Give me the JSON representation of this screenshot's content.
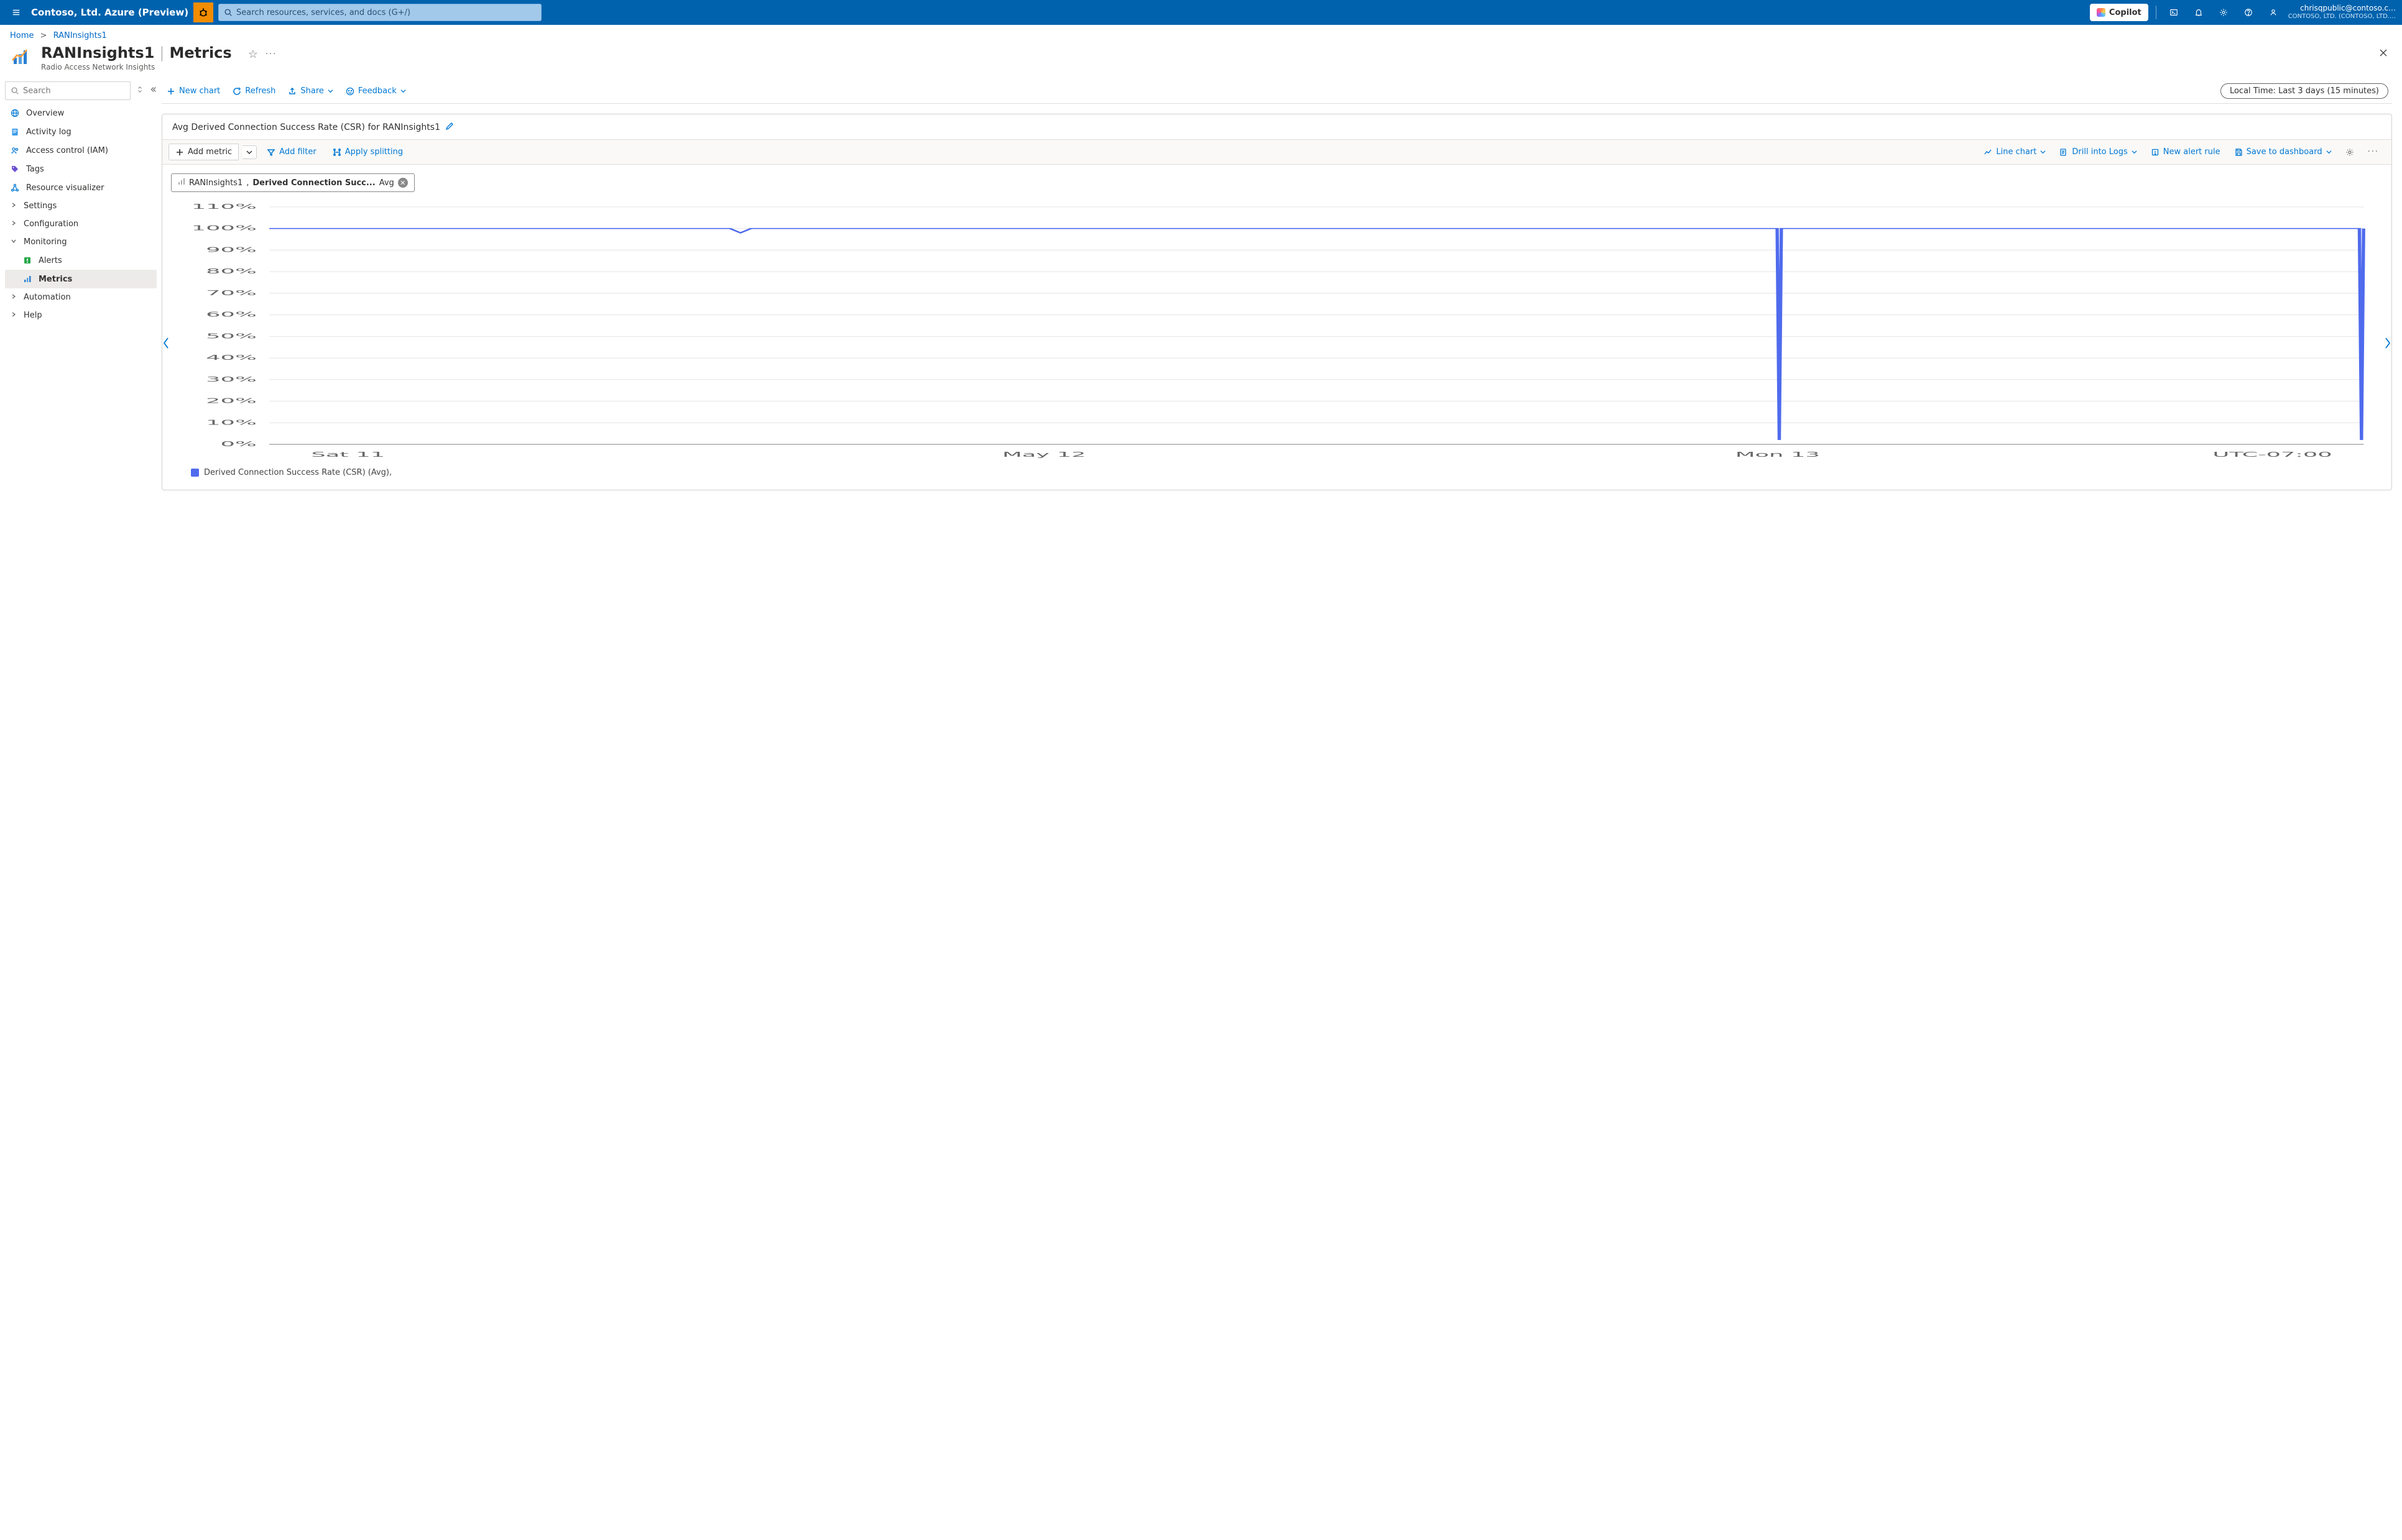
{
  "header": {
    "brand": "Contoso, Ltd. Azure (Preview)",
    "search_placeholder": "Search resources, services, and docs (G+/)",
    "copilot_label": "Copilot",
    "account_email": "chrisqpublic@contoso.c…",
    "account_tenant": "CONTOSO, LTD. (CONTOSO, LTD.…"
  },
  "breadcrumb": {
    "home": "Home",
    "current": "RANInsights1"
  },
  "resource": {
    "title_name": "RANInsights1",
    "title_section": "Metrics",
    "subtitle": "Radio Access Network Insights"
  },
  "sidebar": {
    "search_placeholder": "Search",
    "items": [
      {
        "label": "Overview",
        "icon": "globe"
      },
      {
        "label": "Activity log",
        "icon": "log"
      },
      {
        "label": "Access control (IAM)",
        "icon": "people"
      },
      {
        "label": "Tags",
        "icon": "tag"
      },
      {
        "label": "Resource visualizer",
        "icon": "graph"
      },
      {
        "label": "Settings",
        "icon": "chev"
      },
      {
        "label": "Configuration",
        "icon": "chev"
      },
      {
        "label": "Monitoring",
        "icon": "chev-open",
        "expanded": true
      },
      {
        "label": "Alerts",
        "icon": "alert",
        "sub": true
      },
      {
        "label": "Metrics",
        "icon": "metric",
        "sub": true,
        "selected": true
      },
      {
        "label": "Automation",
        "icon": "chev"
      },
      {
        "label": "Help",
        "icon": "chev"
      }
    ]
  },
  "toolbar": {
    "new_chart": "New chart",
    "refresh": "Refresh",
    "share": "Share",
    "feedback": "Feedback",
    "time_pill": "Local Time: Last 3 days (15 minutes)"
  },
  "chart_card": {
    "title": "Avg Derived Connection Success Rate (CSR) for RANInsights1",
    "add_metric": "Add metric",
    "add_filter": "Add filter",
    "apply_splitting": "Apply splitting",
    "line_chart": "Line chart",
    "drill_logs": "Drill into Logs",
    "new_alert": "New alert rule",
    "save_dashboard": "Save to dashboard",
    "chip_resource": "RANInsights1",
    "chip_metric": "Derived Connection Succ...",
    "chip_agg": "Avg"
  },
  "legend": {
    "label": "Derived Connection Success Rate (CSR) (Avg),",
    "color": "#4f6bed"
  },
  "chart_data": {
    "type": "line",
    "title": "Avg Derived Connection Success Rate (CSR) for RANInsights1",
    "xlabel": "",
    "ylabel": "",
    "y_ticks": [
      "0%",
      "10%",
      "20%",
      "30%",
      "40%",
      "50%",
      "60%",
      "70%",
      "80%",
      "90%",
      "100%",
      "110%"
    ],
    "ylim": [
      0,
      110
    ],
    "x_ticks": [
      "Sat 11",
      "May 12",
      "Mon 13",
      "UTC-07:00"
    ],
    "series": [
      {
        "name": "Derived Connection Success Rate (CSR) (Avg)",
        "color": "#4f6bed",
        "x": [
          0,
          0.08,
          0.22,
          0.225,
          0.23,
          0.72,
          0.721,
          0.722,
          0.73,
          0.998,
          0.999,
          1.0
        ],
        "y": [
          100,
          100,
          100,
          98,
          100,
          100,
          2,
          100,
          100,
          100,
          2,
          100
        ]
      }
    ],
    "tz_note": "UTC-07:00"
  }
}
